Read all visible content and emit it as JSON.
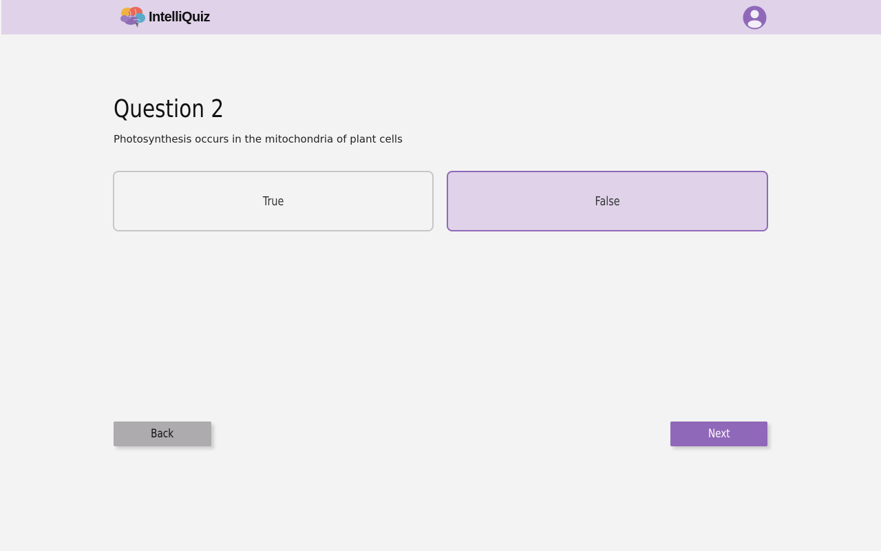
{
  "header": {
    "app_name": "IntelliQuiz",
    "logo_icon": "brain-icon",
    "avatar_icon": "user-avatar-icon"
  },
  "question": {
    "title": "Question 2",
    "text": "Photosynthesis occurs in the mitochondria of plant cells"
  },
  "options": [
    {
      "label": "True",
      "selected": false
    },
    {
      "label": "False",
      "selected": true
    }
  ],
  "navigation": {
    "back_label": "Back",
    "next_label": "Next"
  },
  "colors": {
    "header_bg": "#dfd2e9",
    "page_bg": "#f3f3f3",
    "accent": "#9068b9",
    "selected_bg": "#dfd2e9",
    "back_button": "#adabad"
  }
}
